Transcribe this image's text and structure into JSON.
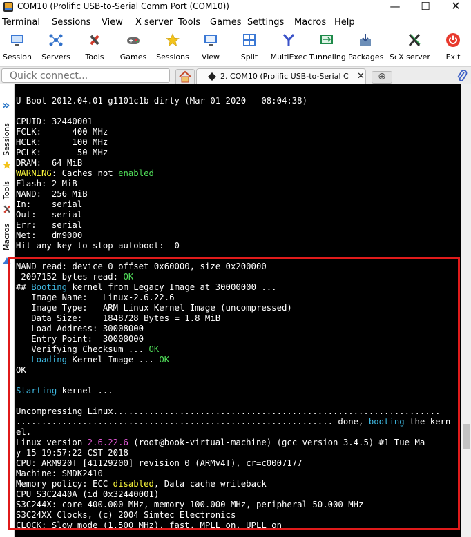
{
  "window": {
    "title": "COM10  (Prolific USB-to-Serial Comm Port (COM10))",
    "minimize_glyph": "—",
    "maximize_glyph": "☐",
    "close_glyph": "✕"
  },
  "menu": [
    "Terminal",
    "Sessions",
    "View",
    "X server",
    "Tools",
    "Games",
    "Settings",
    "Macros",
    "Help"
  ],
  "toolbar": [
    {
      "label": "Session",
      "icon": "session-icon"
    },
    {
      "label": "Servers",
      "icon": "servers-icon"
    },
    {
      "label": "Tools",
      "icon": "tools-icon"
    },
    {
      "label": "Games",
      "icon": "games-icon"
    },
    {
      "label": "Sessions",
      "icon": "sessions-star-icon"
    },
    {
      "label": "View",
      "icon": "view-icon"
    },
    {
      "label": "Split",
      "icon": "split-icon"
    },
    {
      "label": "MultiExec",
      "icon": "multiexec-icon"
    },
    {
      "label": "Tunneling",
      "icon": "tunneling-icon"
    },
    {
      "label": "Packages",
      "icon": "packages-icon"
    },
    {
      "label": "Sc",
      "icon": "settings-icon"
    },
    {
      "label": "X server",
      "icon": "x-server-icon"
    },
    {
      "label": "Exit",
      "icon": "exit-icon"
    }
  ],
  "quick_connect": {
    "placeholder": "Quick connect..."
  },
  "tabs": {
    "active_title": "2. COM10  (Prolific USB-to-Serial C",
    "close_glyph": "✕",
    "new_tab_glyph": "⊕"
  },
  "sidebar": {
    "collapse_glyph": "»",
    "labels": [
      "Sessions",
      "Tools",
      "Macros"
    ]
  },
  "terminal": {
    "lines": [
      [
        {
          "t": "U-Boot 2012.04.01-g1101c1b-dirty (Mar 01 2020 - 08:04:38)"
        }
      ],
      [
        {
          "t": ""
        }
      ],
      [
        {
          "t": "CPUID: 32440001"
        }
      ],
      [
        {
          "t": "FCLK:      400 MHz"
        }
      ],
      [
        {
          "t": "HCLK:      100 MHz"
        }
      ],
      [
        {
          "t": "PCLK:       50 MHz"
        }
      ],
      [
        {
          "t": "DRAM:  64 MiB"
        }
      ],
      [
        {
          "t": "WARNING",
          "c": "yellow"
        },
        {
          "t": ": Caches not "
        },
        {
          "t": "enabled",
          "c": "green"
        }
      ],
      [
        {
          "t": "Flash: 2 MiB"
        }
      ],
      [
        {
          "t": "NAND:  256 MiB"
        }
      ],
      [
        {
          "t": "In:    serial"
        }
      ],
      [
        {
          "t": "Out:   serial"
        }
      ],
      [
        {
          "t": "Err:   serial"
        }
      ],
      [
        {
          "t": "Net:   dm9000"
        }
      ],
      [
        {
          "t": "Hit any key to stop autoboot:  0"
        }
      ],
      [
        {
          "t": ""
        }
      ],
      [
        {
          "t": "NAND read: device 0 offset 0x60000, size 0x200000"
        }
      ],
      [
        {
          "t": " 2097152 bytes read: "
        },
        {
          "t": "OK",
          "c": "green"
        }
      ],
      [
        {
          "t": "## "
        },
        {
          "t": "Booting",
          "c": "cyan"
        },
        {
          "t": " kernel from Legacy Image at 30000000 ..."
        }
      ],
      [
        {
          "t": "   Image Name:   Linux-2.6.22.6"
        }
      ],
      [
        {
          "t": "   Image Type:   ARM Linux Kernel Image (uncompressed)"
        }
      ],
      [
        {
          "t": "   Data Size:    1848728 Bytes = 1.8 MiB"
        }
      ],
      [
        {
          "t": "   Load Address: 30008000"
        }
      ],
      [
        {
          "t": "   Entry Point:  30008000"
        }
      ],
      [
        {
          "t": "   Verifying Checksum ... "
        },
        {
          "t": "OK",
          "c": "green"
        }
      ],
      [
        {
          "t": "   "
        },
        {
          "t": "Loading",
          "c": "cyan"
        },
        {
          "t": " Kernel Image ... "
        },
        {
          "t": "OK",
          "c": "green"
        }
      ],
      [
        {
          "t": "OK"
        }
      ],
      [
        {
          "t": ""
        }
      ],
      [
        {
          "t": "Starting",
          "c": "cyan"
        },
        {
          "t": " kernel ..."
        }
      ],
      [
        {
          "t": ""
        }
      ],
      [
        {
          "t": "Uncompressing Linux................................................................"
        }
      ],
      [
        {
          "t": ".............................................................. done, "
        },
        {
          "t": "booting",
          "c": "cyan"
        },
        {
          "t": " the kern"
        }
      ],
      [
        {
          "t": "el."
        }
      ],
      [
        {
          "t": "Linux version "
        },
        {
          "t": "2.6.22.6",
          "c": "magenta"
        },
        {
          "t": " (root@book-virtual-machine) (gcc version 3.4.5) #1 Tue Ma"
        }
      ],
      [
        {
          "t": "y 15 19:57:22 CST 2018"
        }
      ],
      [
        {
          "t": "CPU: ARM920T [41129200] revision 0 (ARMv4T), cr=c0007177"
        }
      ],
      [
        {
          "t": "Machine: SMDK2410"
        }
      ],
      [
        {
          "t": "Memory policy: ECC "
        },
        {
          "t": "disabled",
          "c": "yellow"
        },
        {
          "t": ", Data cache writeback"
        }
      ],
      [
        {
          "t": "CPU S3C2440A (id 0x32440001)"
        }
      ],
      [
        {
          "t": "S3C244X: core 400.000 MHz, memory 100.000 MHz, peripheral 50.000 MHz"
        }
      ],
      [
        {
          "t": "S3C24XX Clocks, (c) 2004 Simtec Electronics"
        }
      ],
      [
        {
          "t": "CLOCK: Slow mode (1.500 MHz), fast, MPLL on, UPLL on"
        }
      ]
    ]
  },
  "colors": {
    "terminal_bg": "#000000",
    "terminal_fg": "#ffffff",
    "yellow": "#f4f13a",
    "green": "#51e05a",
    "cyan": "#3fb8e0",
    "magenta": "#e55ad9",
    "highlight_box": "#e01b1b"
  }
}
